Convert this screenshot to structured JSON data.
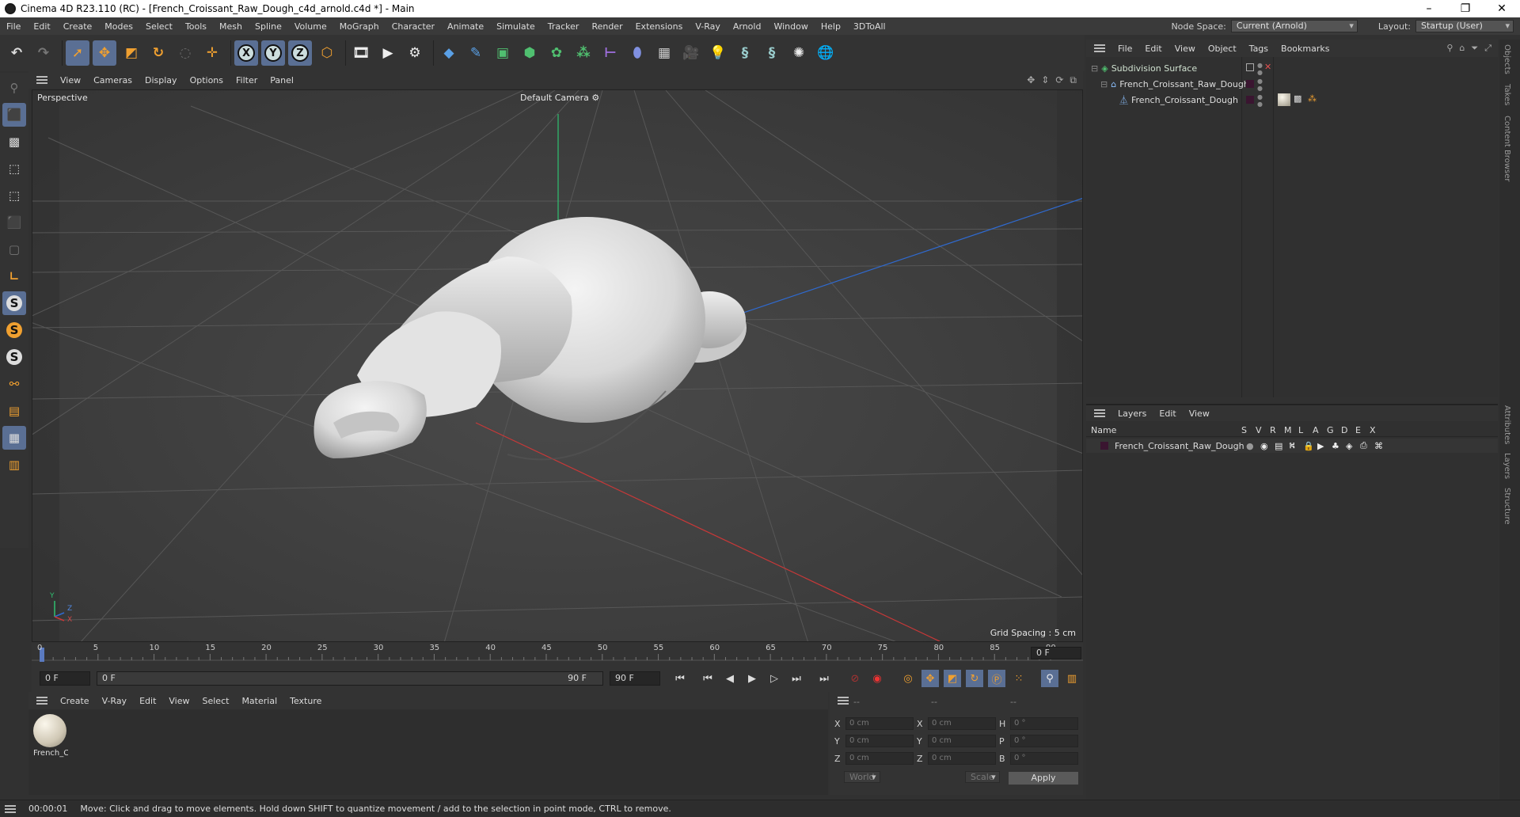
{
  "window": {
    "title": "Cinema 4D R23.110 (RC) - [French_Croissant_Raw_Dough_c4d_arnold.c4d *] - Main",
    "controls": [
      "–",
      "❐",
      "✕"
    ]
  },
  "menubar": {
    "items": [
      "File",
      "Edit",
      "Create",
      "Modes",
      "Select",
      "Tools",
      "Mesh",
      "Spline",
      "Volume",
      "MoGraph",
      "Character",
      "Animate",
      "Simulate",
      "Tracker",
      "Render",
      "Extensions",
      "V-Ray",
      "Arnold",
      "Window",
      "Help",
      "3DToAll"
    ],
    "node_space_label": "Node Space:",
    "node_space_value": "Current (Arnold)",
    "layout_label": "Layout:",
    "layout_value": "Startup (User)"
  },
  "toolbar": {
    "icons": [
      "undo-icon",
      "redo-icon",
      "select-arrow-icon",
      "move-icon",
      "scale-icon",
      "rotate-icon",
      "live-select-icon",
      "transform-icon",
      "x-axis-icon",
      "y-axis-icon",
      "z-axis-icon",
      "world-coordinates-icon",
      "render-region-icon",
      "render-view-icon",
      "render-settings-icon",
      "cube-icon",
      "pen-icon",
      "subdivision-icon",
      "extrude-icon",
      "cloner-icon",
      "array-icon",
      "deformer-icon",
      "environment-icon",
      "floor-icon",
      "camera-icon",
      "light-icon",
      "python-icon",
      "python-2-icon",
      "arnold-icon",
      "globe-icon"
    ],
    "axis_labels": [
      "X",
      "Y",
      "Z"
    ]
  },
  "viewport": {
    "menu": [
      "View",
      "Cameras",
      "Display",
      "Options",
      "Filter",
      "Panel"
    ],
    "projection_label": "Perspective",
    "camera_label": "Default Camera",
    "grid_spacing": "Grid Spacing : 5 cm",
    "axis_gizmo": {
      "y": "Y",
      "z": "Z",
      "x": "X"
    }
  },
  "timeline": {
    "ticks": [
      "0",
      "5",
      "10",
      "15",
      "20",
      "25",
      "30",
      "35",
      "40",
      "45",
      "50",
      "55",
      "60",
      "65",
      "70",
      "75",
      "80",
      "85",
      "90"
    ],
    "current_frame_field": "0 F",
    "start_field": "0 F",
    "range_start": "0 F",
    "range_end": "90 F",
    "end_field": "90 F",
    "frame_right_field": "0 F"
  },
  "materials": {
    "menu": [
      "Create",
      "V-Ray",
      "Edit",
      "View",
      "Select",
      "Material",
      "Texture"
    ],
    "items": [
      {
        "name": "French_C"
      }
    ]
  },
  "coordinates": {
    "headers": [
      "--",
      "--",
      "--"
    ],
    "rows": [
      {
        "axis": "X",
        "pos": "0 cm",
        "axis2": "X",
        "size": "0 cm",
        "axis3": "H",
        "rot": "0 °"
      },
      {
        "axis": "Y",
        "pos": "0 cm",
        "axis2": "Y",
        "size": "0 cm",
        "axis3": "P",
        "rot": "0 °"
      },
      {
        "axis": "Z",
        "pos": "0 cm",
        "axis2": "Z",
        "size": "0 cm",
        "axis3": "B",
        "rot": "0 °"
      }
    ],
    "space_select": "World",
    "mode_select": "Scale",
    "apply_label": "Apply"
  },
  "status": {
    "time": "00:00:01",
    "message": "Move: Click and drag to move elements. Hold down SHIFT to quantize movement / add to the selection in point mode, CTRL to remove."
  },
  "objects_panel": {
    "menu": [
      "File",
      "Edit",
      "View",
      "Object",
      "Tags",
      "Bookmarks"
    ],
    "tree": [
      {
        "name": "Subdivision Surface",
        "indent": 0
      },
      {
        "name": "French_Croissant_Raw_Dough",
        "indent": 1
      },
      {
        "name": "French_Croissant_Dough",
        "indent": 2
      }
    ]
  },
  "layers_panel": {
    "menu": [
      "Layers",
      "Edit",
      "View"
    ],
    "columns": [
      "Name",
      "S",
      "V",
      "R",
      "M",
      "L",
      "A",
      "G",
      "D",
      "E",
      "X"
    ],
    "rows": [
      {
        "name": "French_Croissant_Raw_Dough",
        "color": "#3a1530"
      }
    ]
  },
  "side_tabs": [
    "Objects",
    "Takes",
    "Content Browser",
    "Attributes",
    "Layers",
    "Structure"
  ],
  "colors": {
    "accent": "#5a6f94",
    "axis_x": "#c83232",
    "axis_y": "#32c850",
    "axis_z": "#3264c8",
    "layer_color": "#3a1530"
  }
}
